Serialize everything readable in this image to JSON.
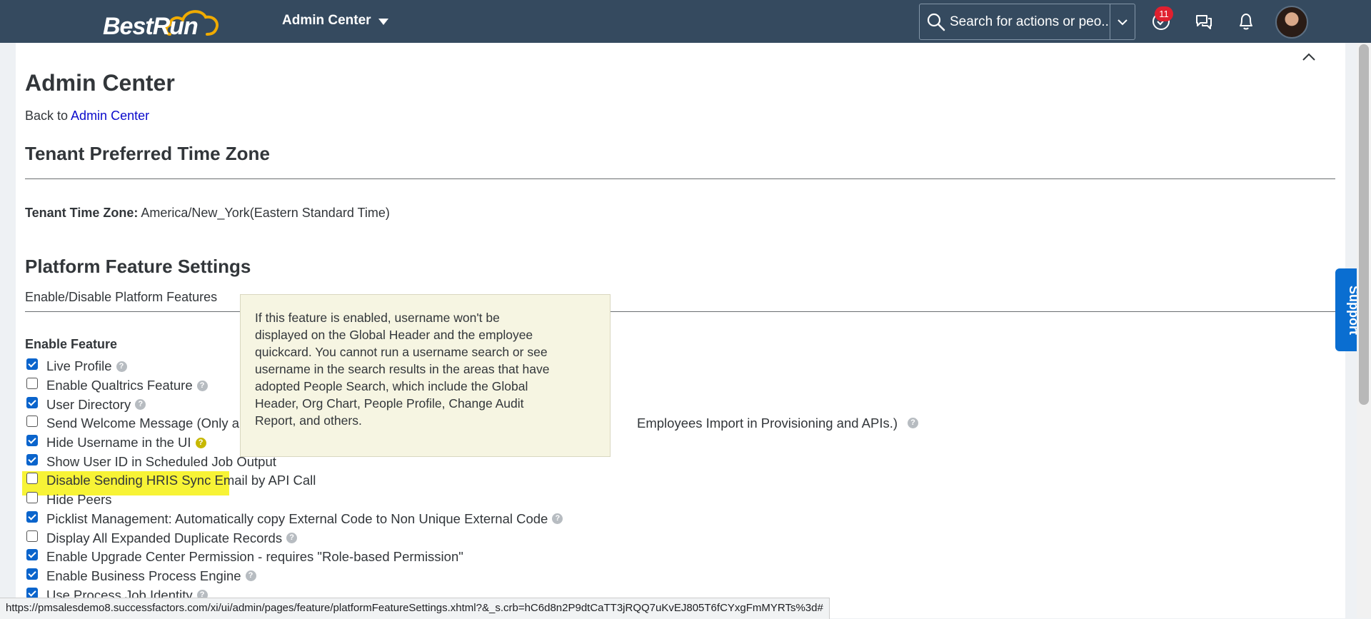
{
  "shellbar": {
    "logo_text": "BestRun",
    "product_menu_label": "Admin Center",
    "search_placeholder": "Search for actions or peo...",
    "notification_count": "11",
    "colors": {
      "background": "#354a5f",
      "accent": "#f0ab00"
    }
  },
  "page": {
    "title": "Admin Center",
    "back_prefix": "Back to",
    "back_link": "Admin Center",
    "tz_section_title": "Tenant Preferred Time Zone",
    "tz_label": "Tenant Time Zone:",
    "tz_value": "America/New_York(Eastern Standard Time)",
    "platform_section_title": "Platform Feature Settings",
    "platform_subtitle": "Enable/Disable Platform Features",
    "enable_feature_label": "Enable Feature"
  },
  "features": [
    {
      "label": "Live Profile",
      "checked": true,
      "help": true
    },
    {
      "label": "Enable Qualtrics Feature",
      "checked": false,
      "help": true
    },
    {
      "label": "User Directory",
      "checked": true,
      "help": true
    },
    {
      "label": "Send Welcome Message (Only a",
      "label_tail": "Employees Import in Provisioning and APIs.)",
      "checked": false,
      "help": true
    },
    {
      "label": "Hide Username in the UI",
      "checked": true,
      "help": true,
      "highlighted": true
    },
    {
      "label": "Show User ID in Scheduled Job Output",
      "checked": true,
      "help": false
    },
    {
      "label": "Disable Sending HRIS Sync Email by API Call",
      "checked": false,
      "help": false
    },
    {
      "label": "Hide Peers",
      "checked": false,
      "help": false
    },
    {
      "label": "Picklist Management: Automatically copy External Code to Non Unique External Code",
      "checked": true,
      "help": true
    },
    {
      "label": "Display All Expanded Duplicate Records",
      "checked": false,
      "help": true
    },
    {
      "label": "Enable Upgrade Center Permission - requires \"Role-based Permission\"",
      "checked": true,
      "help": false
    },
    {
      "label": "Enable Business Process Engine",
      "checked": true,
      "help": true
    },
    {
      "label": "Use Process Job Identity",
      "checked": true,
      "help": true
    }
  ],
  "tooltip": {
    "text": "If this feature is enabled, username won't be displayed on the Global Header and the employee quickcard. You cannot run a username search or see username in the search results in the areas that have adopted People Search, which include the Global Header, Org Chart, People Profile, Change Audit Report, and others."
  },
  "support_tab_label": "Support",
  "status_url": "https://pmsalesdemo8.successfactors.com/xi/ui/admin/pages/feature/platformFeatureSettings.xhtml?&_s.crb=hC6d8n2P9dtCaTT3jRQQ7uKvEJ805T6fCYxgFmMYRTs%3d#"
}
